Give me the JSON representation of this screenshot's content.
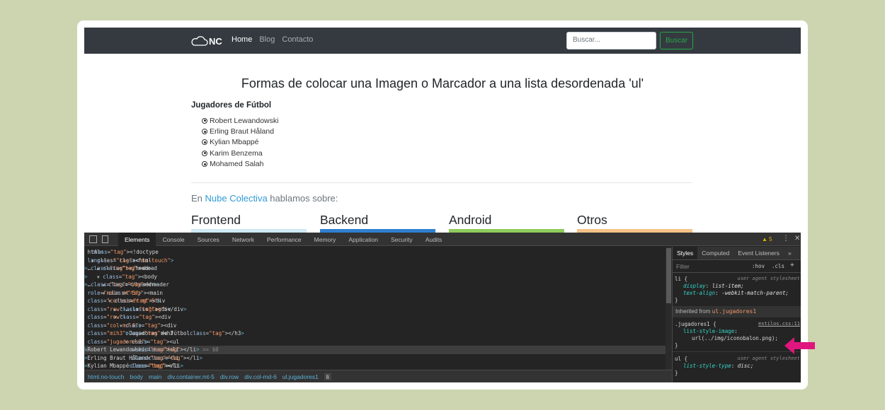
{
  "navbar": {
    "brand": "NC",
    "links": [
      "Home",
      "Blog",
      "Contacto"
    ],
    "search_placeholder": "Buscar...",
    "search_button": "Buscar"
  },
  "content": {
    "title": "Formas de colocar una Imagen o Marcador a una lista desordenada 'ul'",
    "list_title": "Jugadores de Fútbol",
    "players": [
      "Robert Lewandowski",
      "Erling Braut Håland",
      "Kylian Mbappé",
      "Karim Benzema",
      "Mohamed Salah"
    ],
    "about_prefix": "En ",
    "about_link": "Nube Colectiva",
    "about_suffix": " hablamos sobre:",
    "categories": [
      {
        "name": "Frontend",
        "color": "#cfe9f5"
      },
      {
        "name": "Backend",
        "color": "#2f7fd0"
      },
      {
        "name": "Android",
        "color": "#8fcb5c"
      },
      {
        "name": "Otros",
        "color": "#f5c287"
      }
    ]
  },
  "devtools": {
    "tabs": [
      "Elements",
      "Console",
      "Sources",
      "Network",
      "Performance",
      "Memory",
      "Application",
      "Security",
      "Audits"
    ],
    "active_tab": "Elements",
    "warnings": "5",
    "dom_lines": [
      {
        "t": "doctype",
        "text": "<!doctype html>"
      },
      {
        "t": "open",
        "text": "<html lang=\"es\" class=\"no-touch\">"
      },
      {
        "t": "c",
        "text": "<head>…</head>"
      },
      {
        "t": "o",
        "text": "<body>"
      },
      {
        "t": "c",
        "text": "<header>…</header>"
      },
      {
        "t": "o",
        "text": "<main role=\"main mt-5\">"
      },
      {
        "t": "o",
        "text": "<div class=\"container mt-5\">"
      },
      {
        "t": "c",
        "text": "<div class=\"row\">…</div>"
      },
      {
        "t": "o",
        "text": "<div class=\"row\">"
      },
      {
        "t": "o",
        "text": "<div class=\"col-md-6\">"
      },
      {
        "t": "l",
        "text": "<h3 class=\"mih3\">Jugadores de Fútbol</h3>"
      },
      {
        "t": "o",
        "text": "<ul class=\"jugadores1\">"
      },
      {
        "t": "l",
        "text": "<li>Robert Lewandowski</li> == $0"
      },
      {
        "t": "l",
        "text": "<li>Erling Braut Håland</li>"
      },
      {
        "t": "l",
        "text": "<li>Kylian Mbappé</li>"
      }
    ],
    "breadcrumbs": [
      "html.no-touch",
      "body",
      "main",
      "div.container.mt-5",
      "div.row",
      "div.col-md-6",
      "ul.jugadores1",
      "li"
    ],
    "styles_tabs": [
      "Styles",
      "Computed",
      "Event Listeners",
      "»"
    ],
    "filter_placeholder": "Filter",
    "filter_hov": ":hov",
    "filter_cls": ".cls",
    "filter_plus": "+",
    "rule_li": {
      "selector": "li {",
      "source": "user agent stylesheet",
      "p1": "display",
      "v1": "list-item;",
      "p2": "text-align",
      "v2": "-webkit-match-parent;"
    },
    "inherited_label": "Inherited from ",
    "inherited_selector": "ul.jugadores1",
    "rule_jug": {
      "selector": ".jugadores1 {",
      "source": "estilos.css:11",
      "p1": "list-style-image",
      "v1": "url(../img/iconobalon.png);"
    },
    "rule_ul": {
      "selector": "ul {",
      "source": "user agent stylesheet",
      "p1": "list-style-type",
      "v1": "disc;"
    }
  },
  "colors": {
    "navbar": "#343a40",
    "success": "#28a745",
    "link": "#2f9bd6",
    "arrow": "#e0157f",
    "background": "#ccd5b0"
  }
}
